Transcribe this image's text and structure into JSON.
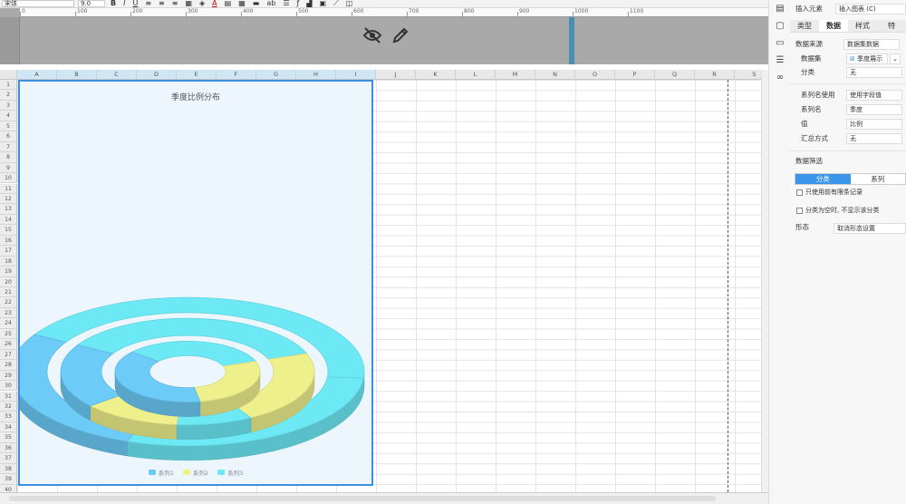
{
  "toolbar": {
    "font": "宋体",
    "font_size": "9.0",
    "bold": "B",
    "italic": "I",
    "underline": "U",
    "text_a": "A",
    "ab": "ab"
  },
  "ruler": {
    "marks": [
      "0",
      "100",
      "200",
      "300",
      "400",
      "500",
      "600",
      "700",
      "800",
      "900",
      "1000",
      "1100"
    ]
  },
  "grid": {
    "columns": [
      "A",
      "B",
      "C",
      "D",
      "E",
      "F",
      "G",
      "H",
      "I",
      "J",
      "K",
      "L",
      "M",
      "N",
      "O",
      "P",
      "Q",
      "R",
      "S"
    ],
    "rows": [
      "1",
      "2",
      "3",
      "4",
      "5",
      "6",
      "7",
      "8",
      "9",
      "10",
      "11",
      "12",
      "13",
      "14",
      "15",
      "16",
      "17",
      "18",
      "19",
      "20",
      "21",
      "22",
      "23",
      "24",
      "25",
      "26",
      "27",
      "28",
      "29",
      "30",
      "31",
      "32",
      "33",
      "34",
      "35",
      "36",
      "37",
      "38",
      "39",
      "40"
    ]
  },
  "chart_data": {
    "type": "pie",
    "variant": "3d-multi-ring",
    "title": "季度比例分布",
    "series": [
      {
        "name": "系列1",
        "color": "#6ccbf7"
      },
      {
        "name": "系列2",
        "color": "#eef08c"
      },
      {
        "name": "系列3",
        "color": "#6de9f5"
      }
    ],
    "legend_position": "bottom"
  },
  "panel": {
    "insert_element_label": "插入元素",
    "insert_element_value": "插入图表 (C)",
    "tabs": [
      "类型",
      "数据",
      "样式",
      "特"
    ],
    "active_tab": "数据",
    "data_source_label": "数据来源",
    "data_source_value": "数据集数据",
    "dataset_label": "数据集",
    "dataset_value": "季度展示",
    "category_label": "分类",
    "category_value": "无",
    "series_name_use_label": "系列名使用",
    "series_name_use_value": "使用字段值",
    "series_name_label": "系列名",
    "series_name_value": "季度",
    "value_label": "值",
    "value_value": "比例",
    "summary_label": "汇总方式",
    "summary_value": "无",
    "filter_title": "数据筛选",
    "filter_tabs": [
      "分类",
      "系列"
    ],
    "filter_active": "分类",
    "only_first_label": "只使用前有限条记录",
    "hide_empty_label": "分类为空时, 不显示该分类",
    "form_label": "形态",
    "form_value": "取消形态设置"
  },
  "icons": [
    "eye-off-icon",
    "pencil-icon",
    "chart-settings-icon",
    "crop-icon",
    "frame-icon",
    "layers-icon",
    "link-icon"
  ]
}
